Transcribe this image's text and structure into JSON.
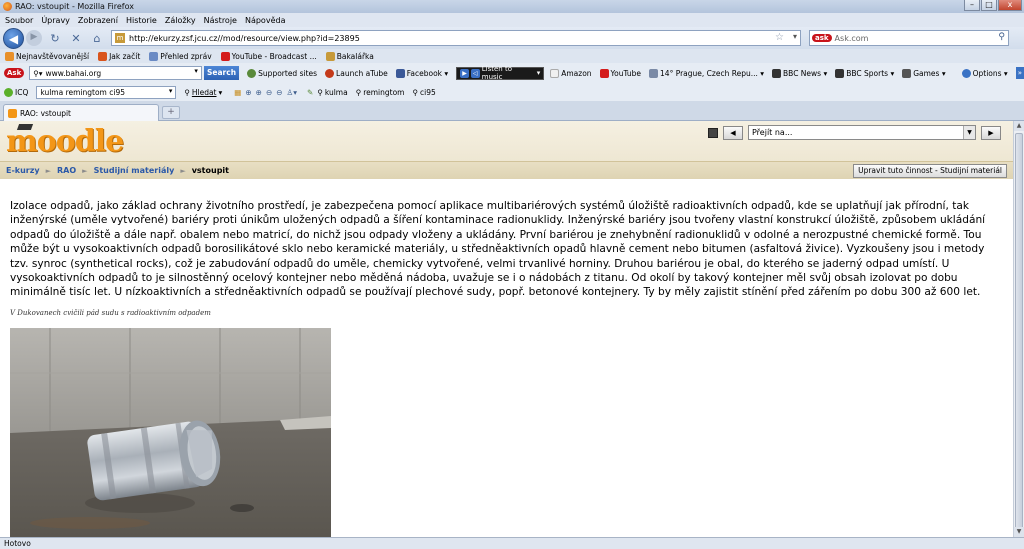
{
  "window": {
    "title": "RAO: vstoupit - Mozilla Firefox",
    "minimize": "–",
    "maximize": "□",
    "close": "x"
  },
  "menu": [
    "Soubor",
    "Úpravy",
    "Zobrazení",
    "Historie",
    "Záložky",
    "Nástroje",
    "Nápověda"
  ],
  "nav": {
    "url": "http://ekurzy.zsf.jcu.cz//mod/resource/view.php?id=23895",
    "search_placeholder": "Ask.com"
  },
  "bookmarks": [
    {
      "label": "Nejnavštěvovanější",
      "color": "#e8902a"
    },
    {
      "label": "Jak začít",
      "color": "#d9541c"
    },
    {
      "label": "Přehled zpráv",
      "color": "#6a8ac4"
    },
    {
      "label": "YouTube - Broadcast ...",
      "color": "#d41b1b"
    },
    {
      "label": "Bakalářka",
      "color": "#c79a3a"
    }
  ],
  "toolbar": {
    "ask_logo": "Ask",
    "search_value": "www.bahai.org",
    "search_button": "Search",
    "items": [
      "Supported sites",
      "Launch aTube",
      "Facebook ▾"
    ],
    "music_label": "Listen to music",
    "items2": [
      "Amazon",
      "YouTube",
      "14° Prague, Czech Repu... ▾",
      "BBC News ▾",
      "BBC Sports ▾",
      "Games ▾"
    ],
    "options": "Options ▾"
  },
  "toolbar2": {
    "icq": "ICQ",
    "input_value": "kulma remingtom ci95",
    "hledat": "Hledat",
    "tags": [
      "kulma",
      "remingtom",
      "ci95"
    ]
  },
  "tab": {
    "title": "RAO: vstoupit",
    "new_tab": "+"
  },
  "page": {
    "logo": "moodle",
    "jump_placeholder": "Přejít na...",
    "breadcrumb": [
      "E-kurzy",
      "RAO",
      "Studijní materiály",
      "vstoupit"
    ],
    "edit_button": "Upravit tuto činnost - Studijní materiál",
    "body": "Izolace odpadů, jako základ ochrany životního prostředí, je zabezpečena pomocí aplikace multibariérových systémů úložiště radioaktivních odpadů, kde se uplatňují jak přírodní, tak inženýrské (uměle vytvořené) bariéry proti únikům uložených odpadů a šíření kontaminace radionuklidy. Inženýrské bariéry jsou tvořeny vlastní konstrukcí úložiště, způsobem ukládání odpadů do úložiště a dále např. obalem nebo matricí, do nichž jsou odpady vloženy a ukládány. První bariérou je znehybnění radionuklidů v odolné a nerozpustné chemické formě. Tou může být u vysokoaktivních odpadů borosilikátové sklo nebo keramické materiály, u středněaktivních opadů hlavně cement nebo bitumen (asfaltová živice). Vyzkoušeny jsou i metody tzv. synroc (synthetical rocks), což je zabudování odpadů do uměle, chemicky vytvořené, velmi trvanlivé horniny. Druhou bariérou je obal, do kterého se jaderný odpad umístí. U vysokoaktivních odpadů to je silnostěnný ocelový kontejner nebo měděná nádoba, uvažuje se i o nádobách z titanu. Od okolí by takový kontejner měl svůj obsah izolovat po dobu minimálně tisíc let. U nízkoaktivních a středněaktivních odpadů se používají plechové sudy, popř. betonové kontejnery. Ty by měly zajistit stínění před zářením po dobu 300 až 600 let.",
    "caption": "V Dukovanech cvičili pád sudu s radioaktivním odpadem"
  },
  "status": "Hotovo"
}
